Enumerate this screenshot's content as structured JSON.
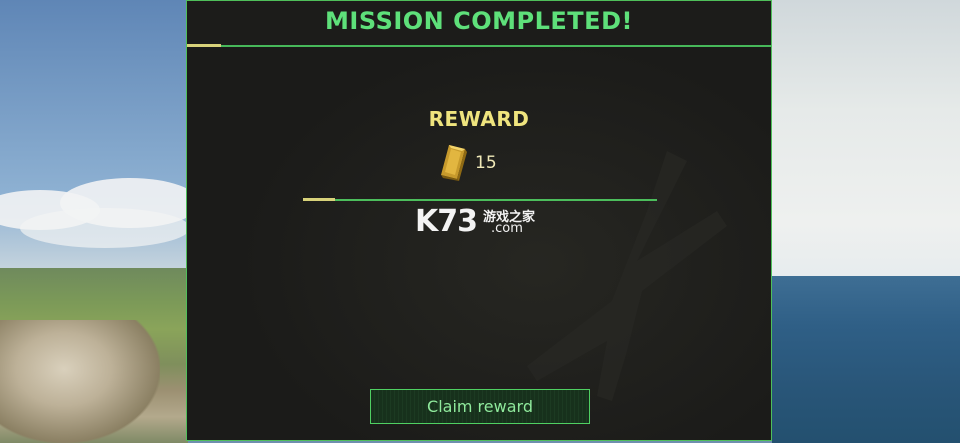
{
  "dialog": {
    "title": "MISSION COMPLETED!",
    "reward_label": "REWARD",
    "reward_amount": "15",
    "reward_icon": "gold-bar-icon",
    "claim_button_label": "Claim reward"
  },
  "watermark": {
    "main": "K73",
    "chinese": "游戏之家",
    "domain": ".com"
  },
  "colors": {
    "title_green": "#5ee07a",
    "reward_yellow": "#efe47e",
    "border_green": "#4fbf5a",
    "panel_bg": "#1b1b19"
  }
}
